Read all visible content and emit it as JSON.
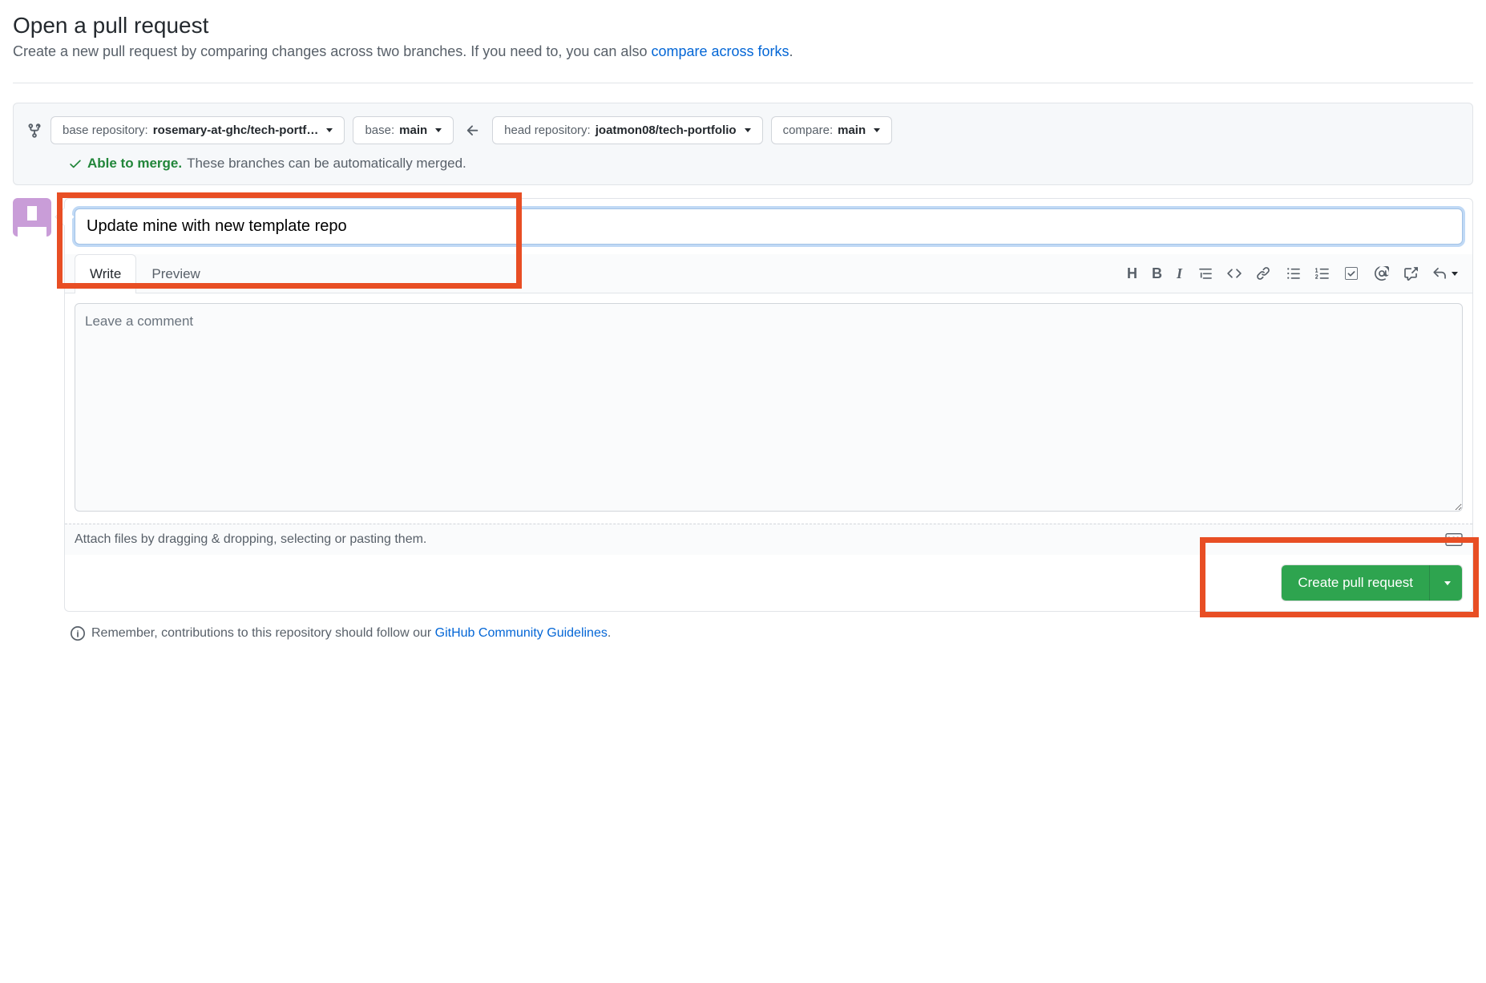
{
  "header": {
    "title": "Open a pull request",
    "subtitle_pre": "Create a new pull request by comparing changes across two branches. If you need to, you can also ",
    "subtitle_link": "compare across forks",
    "subtitle_post": "."
  },
  "compare": {
    "base_repo_prefix": "base repository: ",
    "base_repo_value": "rosemary-at-ghc/tech-portf…",
    "base_branch_prefix": "base: ",
    "base_branch_value": "main",
    "head_repo_prefix": "head repository: ",
    "head_repo_value": "joatmon08/tech-portfolio",
    "compare_branch_prefix": "compare: ",
    "compare_branch_value": "main"
  },
  "merge_status": {
    "able": "Able to merge.",
    "desc": "These branches can be automatically merged."
  },
  "pr": {
    "title_value": "Update mine with new template repo",
    "tabs": {
      "write": "Write",
      "preview": "Preview"
    },
    "comment_placeholder": "Leave a comment",
    "attach_hint": "Attach files by dragging & dropping, selecting or pasting them.",
    "submit_label": "Create pull request"
  },
  "footer": {
    "pre": "Remember, contributions to this repository should follow our ",
    "link": "GitHub Community Guidelines",
    "post": "."
  },
  "icons": {
    "heading": "H",
    "bold": "B"
  }
}
